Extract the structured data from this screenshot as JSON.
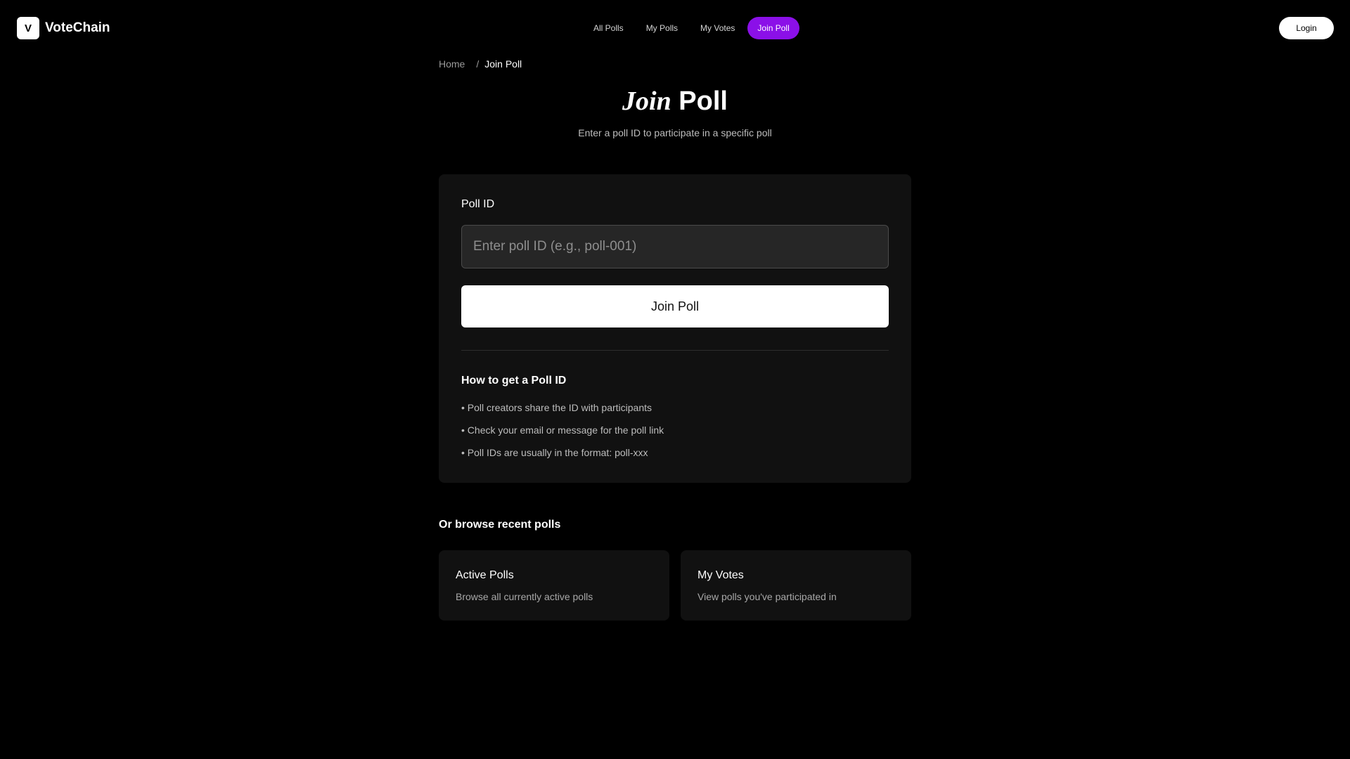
{
  "brand": {
    "badge": "V",
    "name": "VoteChain"
  },
  "nav": {
    "items": [
      {
        "label": "All Polls"
      },
      {
        "label": "My Polls"
      },
      {
        "label": "My Votes"
      },
      {
        "label": "Join Poll"
      }
    ],
    "active_index": 3,
    "active_color": "#8b10e8"
  },
  "header": {
    "login_label": "Login"
  },
  "breadcrumb": {
    "home": "Home",
    "separator": "/",
    "current": "Join Poll"
  },
  "page": {
    "title_italic": "Join",
    "title_regular": "Poll",
    "subtitle": "Enter a poll ID to participate in a specific poll"
  },
  "form": {
    "field_label": "Poll ID",
    "input_value": "",
    "input_placeholder": "Enter poll ID (e.g., poll-001)",
    "submit_label": "Join Poll"
  },
  "howto": {
    "title": "How to get a Poll ID",
    "items": [
      "• Poll creators share the ID with participants",
      "• Check your email or message for the poll link",
      "• Poll IDs are usually in the format: poll-xxx"
    ]
  },
  "browse": {
    "title": "Or browse recent polls",
    "cards": [
      {
        "title": "Active Polls",
        "description": "Browse all currently active polls"
      },
      {
        "title": "My Votes",
        "description": "View polls you've participated in"
      }
    ]
  }
}
